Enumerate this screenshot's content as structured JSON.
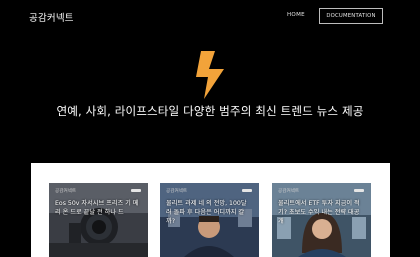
{
  "header": {
    "logo": "공감커넥트",
    "nav": {
      "home": "HOME",
      "documentation": "DOCUMENTATION"
    }
  },
  "hero": {
    "icon": "lightning-bolt-icon",
    "accent_color": "#f2a33a",
    "tagline": "연예, 사회, 라이프스타일 다양한 범주의 최신 트렌드 뉴스 제공"
  },
  "cards": [
    {
      "category": "공감커넥트",
      "title": "Eos 50v 자서시브 프리즈 기 메리 온 드로 끝날 전 하나 드"
    },
    {
      "category": "공감커넥트",
      "title": "물리트 과제 네 의 전망, 100달러 돌파 후 다음은 어디까지 갈까?"
    },
    {
      "category": "공감커넥트",
      "title": "물리트에서 ETF 투자 지금이 적기? 초보도 수익 내는 전략 대공개"
    }
  ]
}
